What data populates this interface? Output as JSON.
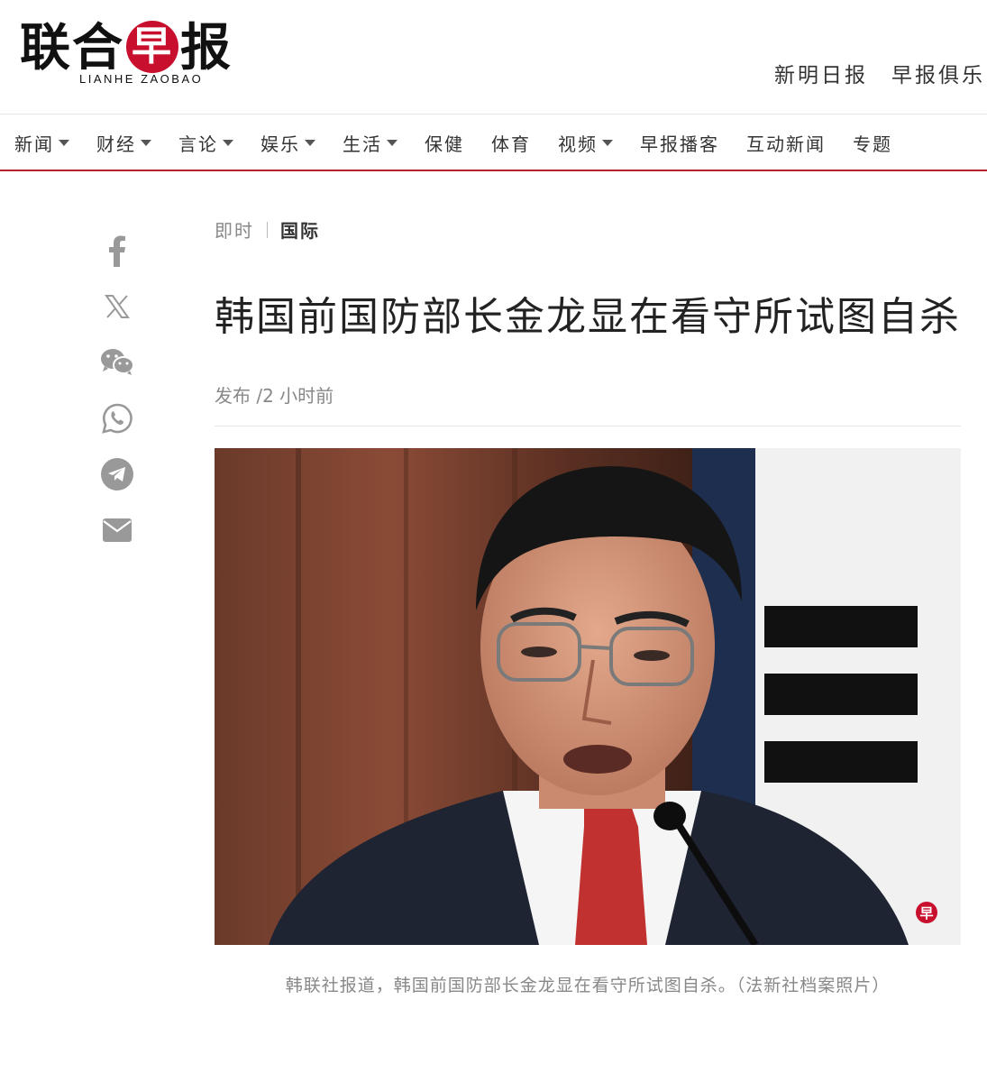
{
  "brand": {
    "logo_cn_1": "联合",
    "logo_cn_mark": "早",
    "logo_cn_2": "报",
    "logo_en": "LIANHE ZAOBAO"
  },
  "top_links": [
    "新明日报",
    "早报俱乐"
  ],
  "nav": [
    {
      "label": "新闻",
      "dropdown": true
    },
    {
      "label": "财经",
      "dropdown": true
    },
    {
      "label": "言论",
      "dropdown": true
    },
    {
      "label": "娱乐",
      "dropdown": true
    },
    {
      "label": "生活",
      "dropdown": true
    },
    {
      "label": "保健",
      "dropdown": false
    },
    {
      "label": "体育",
      "dropdown": false
    },
    {
      "label": "视频",
      "dropdown": true
    },
    {
      "label": "早报播客",
      "dropdown": false
    },
    {
      "label": "互动新闻",
      "dropdown": false
    },
    {
      "label": "专题",
      "dropdown": false
    }
  ],
  "share_icons": [
    "facebook-icon",
    "x-icon",
    "wechat-icon",
    "whatsapp-icon",
    "telegram-icon",
    "email-icon"
  ],
  "article": {
    "breadcrumb_1": "即时",
    "breadcrumb_2": "国际",
    "headline": "韩国前国防部长金龙显在看守所试图自杀",
    "meta": "发布 /2 小时前",
    "caption": "韩联社报道，韩国前国防部长金龙显在看守所试图自杀。（法新社档案照片）",
    "photo_watermark": "早"
  },
  "colors": {
    "brand_red": "#c8102e",
    "nav_rule": "#b3202f",
    "icon_gray": "#999999"
  }
}
